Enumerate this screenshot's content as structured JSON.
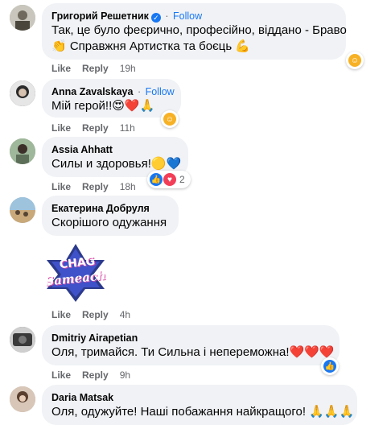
{
  "comments": [
    {
      "author": "Григорий Решетник",
      "verified": true,
      "follow_label": "Follow",
      "lines": [
        "Так, це було феєрично, професійно, віддано - Браво",
        "👏 Справжня Артистка та боєць 💪"
      ],
      "like_label": "Like",
      "reply_label": "Reply",
      "time": "19h",
      "reactions": [
        "care-icon"
      ],
      "avatar_color": "#a3a59a"
    },
    {
      "author": "Anna Zavalskaya",
      "follow_label": "Follow",
      "lines": [
        "Мій герой!!😍❤️🙏"
      ],
      "like_label": "Like",
      "reply_label": "Reply",
      "time": "11h",
      "reactions": [
        "care-icon"
      ],
      "avatar_color": "#3b3b3b"
    },
    {
      "author": "Assia Ahhatt",
      "lines": [
        "Силы и здоровья!🟡💙"
      ],
      "like_label": "Like",
      "reply_label": "Reply",
      "time": "18h",
      "reactions": [
        "like-icon",
        "love-icon"
      ],
      "reaction_count": "2",
      "avatar_color": "#7a9a78"
    },
    {
      "author": "Екатерина Добруля",
      "lines": [
        "Скорішого одужання"
      ],
      "like_label": "Like",
      "reply_label": "Reply",
      "time": "4h",
      "sticker_text": [
        "CHAG",
        "Sameach"
      ],
      "avatar_color": "#8fa6b5"
    },
    {
      "author": "Dmitriy Airapetian",
      "lines": [
        "Оля, тримайся. Ти Сильна і непереможна!❤️❤️❤️"
      ],
      "like_label": "Like",
      "reply_label": "Reply",
      "time": "9h",
      "reactions": [
        "like-icon"
      ],
      "avatar_color": "#5a5a5a"
    },
    {
      "author": "Daria Matsak",
      "lines": [
        "Оля, одужуйте! Наші побажання найкращого! 🙏🙏🙏"
      ],
      "avatar_color": "#b49b86"
    }
  ],
  "colors": {
    "bubble": "#f0f2f5",
    "link": "#1877f2",
    "meta": "#65676b",
    "text": "#050505"
  }
}
